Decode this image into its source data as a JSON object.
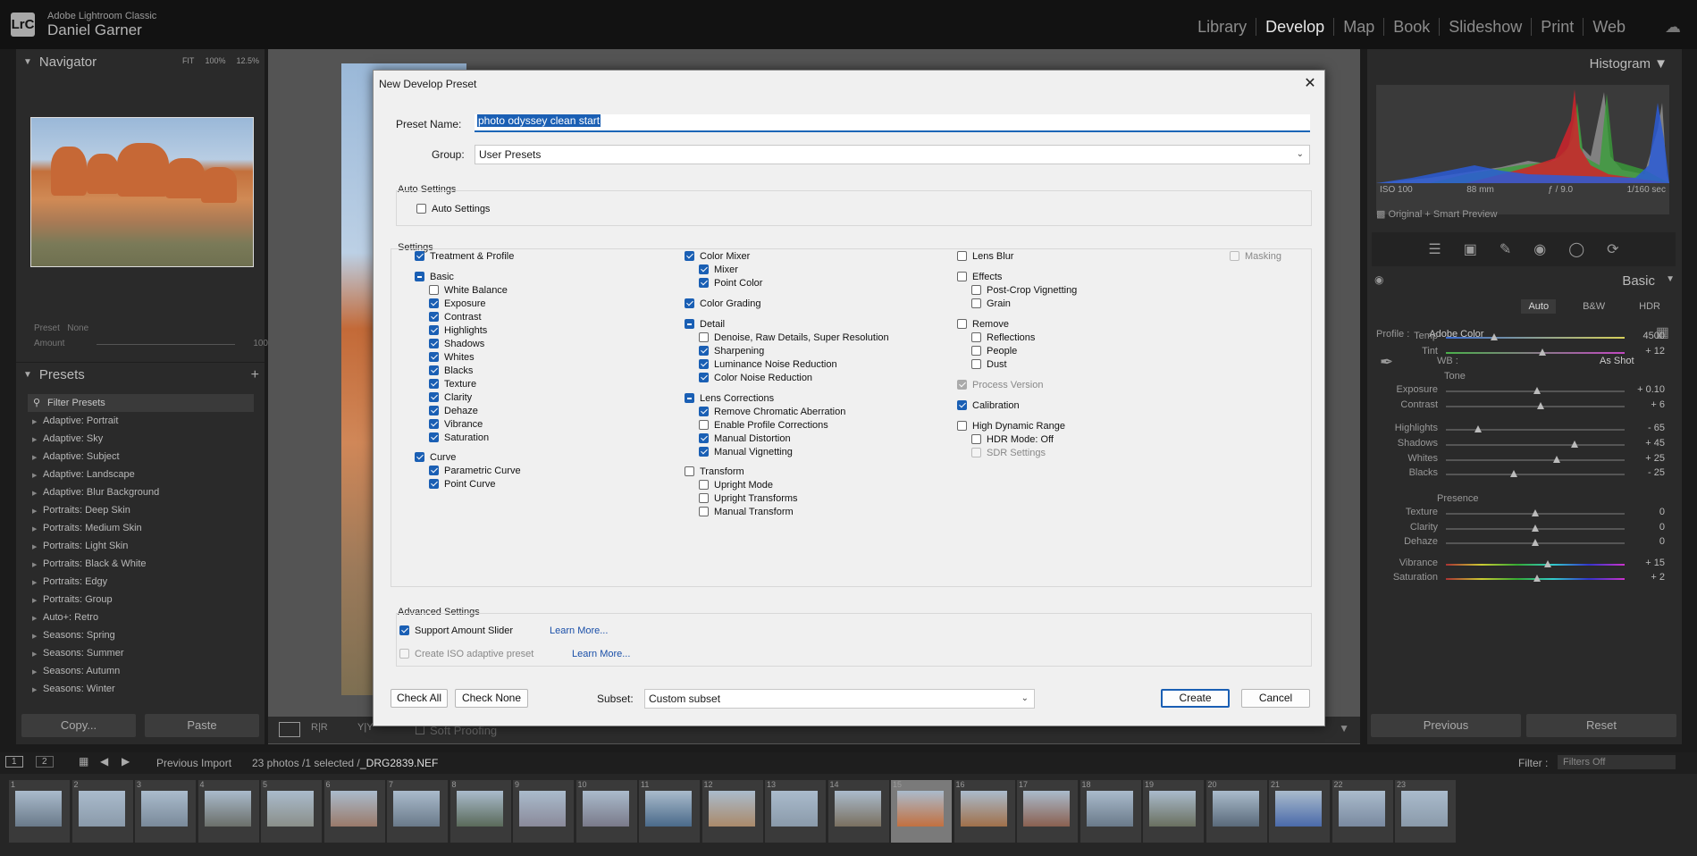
{
  "app": {
    "logo": "LrC",
    "name": "Adobe Lightroom Classic",
    "user": "Daniel Garner"
  },
  "modules": [
    "Library",
    "Develop",
    "Map",
    "Book",
    "Slideshow",
    "Print",
    "Web"
  ],
  "active_module": "Develop",
  "left": {
    "navigator": {
      "title": "Navigator",
      "zoom": [
        "FIT",
        "100%",
        "12.5%"
      ]
    },
    "preset": {
      "label": "Preset",
      "value": "None",
      "amount_label": "Amount",
      "amount_value": "100"
    },
    "presets_title": "Presets",
    "filter_placeholder": "Filter Presets",
    "preset_groups": [
      "Adaptive: Portrait",
      "Adaptive: Sky",
      "Adaptive: Subject",
      "Adaptive: Landscape",
      "Adaptive: Blur Background",
      "Portraits: Deep Skin",
      "Portraits: Medium Skin",
      "Portraits: Light Skin",
      "Portraits: Black & White",
      "Portraits: Edgy",
      "Portraits: Group",
      "Auto+: Retro",
      "Seasons: Spring",
      "Seasons: Summer",
      "Seasons: Autumn",
      "Seasons: Winter"
    ],
    "copy": "Copy...",
    "paste": "Paste"
  },
  "center": {
    "soft_proofing": "Soft Proofing"
  },
  "right": {
    "histogram": "Histogram",
    "meta": [
      "ISO 100",
      "88 mm",
      "ƒ / 9.0",
      "1/160 sec"
    ],
    "smart_preview": "Original + Smart Preview",
    "basic": "Basic",
    "treatment": [
      "Auto",
      "B&W",
      "HDR"
    ],
    "profile_label": "Profile :",
    "profile_value": "Adobe Color",
    "wb_label": "WB :",
    "wb_value": "As Shot",
    "temp": {
      "label": "Temp",
      "value": "4500",
      "pos": 0.27
    },
    "tint": {
      "label": "Tint",
      "value": "+ 12",
      "pos": 0.54
    },
    "tone": "Tone",
    "exposure": {
      "label": "Exposure",
      "value": "+ 0.10",
      "pos": 0.51
    },
    "contrast": {
      "label": "Contrast",
      "value": "+ 6",
      "pos": 0.53
    },
    "highlights": {
      "label": "Highlights",
      "value": "- 65",
      "pos": 0.18
    },
    "shadows": {
      "label": "Shadows",
      "value": "+ 45",
      "pos": 0.72
    },
    "whites": {
      "label": "Whites",
      "value": "+ 25",
      "pos": 0.62
    },
    "blacks": {
      "label": "Blacks",
      "value": "- 25",
      "pos": 0.38
    },
    "presence": "Presence",
    "texture": {
      "label": "Texture",
      "value": "0",
      "pos": 0.5
    },
    "clarity": {
      "label": "Clarity",
      "value": "0",
      "pos": 0.5
    },
    "dehaze": {
      "label": "Dehaze",
      "value": "0",
      "pos": 0.5
    },
    "vibrance": {
      "label": "Vibrance",
      "value": "+ 15",
      "pos": 0.57
    },
    "saturation": {
      "label": "Saturation",
      "value": "+ 2",
      "pos": 0.51
    },
    "previous": "Previous",
    "reset": "Reset"
  },
  "filmstrip": {
    "source": "Previous Import",
    "count": "23 photos /1 selected /",
    "file": "_DRG2839.NEF",
    "filter_label": "Filter :",
    "filter_value": "Filters Off",
    "screen1": "1",
    "screen2": "2",
    "selected_index": 15
  },
  "dialog": {
    "title": "New Develop Preset",
    "preset_name_label": "Preset Name:",
    "preset_name": "photo odyssey clean start",
    "group_label": "Group:",
    "group_value": "User Presets",
    "auto_settings_title": "Auto Settings",
    "auto_settings": "Auto Settings",
    "settings_title": "Settings",
    "col1": [
      "Treatment & Profile",
      "Basic",
      "White Balance",
      "Exposure",
      "Contrast",
      "Highlights",
      "Shadows",
      "Whites",
      "Blacks",
      "Texture",
      "Clarity",
      "Dehaze",
      "Vibrance",
      "Saturation",
      "Curve",
      "Parametric Curve",
      "Point Curve"
    ],
    "col2": [
      "Color Mixer",
      "Mixer",
      "Point Color",
      "Color Grading",
      "Detail",
      "Denoise, Raw Details, Super Resolution",
      "Sharpening",
      "Luminance Noise Reduction",
      "Color Noise Reduction",
      "Lens Corrections",
      "Remove Chromatic Aberration",
      "Enable Profile Corrections",
      "Manual Distortion",
      "Manual Vignetting",
      "Transform",
      "Upright Mode",
      "Upright Transforms",
      "Manual Transform"
    ],
    "col3": [
      "Lens Blur",
      "Effects",
      "Post-Crop Vignetting",
      "Grain",
      "Remove",
      "Reflections",
      "People",
      "Dust",
      "Process Version",
      "Calibration",
      "High Dynamic Range",
      "HDR Mode: Off",
      "SDR Settings"
    ],
    "masking": "Masking",
    "advanced_title": "Advanced Settings",
    "support_amount": "Support Amount Slider",
    "create_iso": "Create ISO adaptive preset",
    "learn_more": "Learn More...",
    "check_all": "Check All",
    "check_none": "Check None",
    "subset_label": "Subset:",
    "subset_value": "Custom subset",
    "create": "Create",
    "cancel": "Cancel"
  }
}
